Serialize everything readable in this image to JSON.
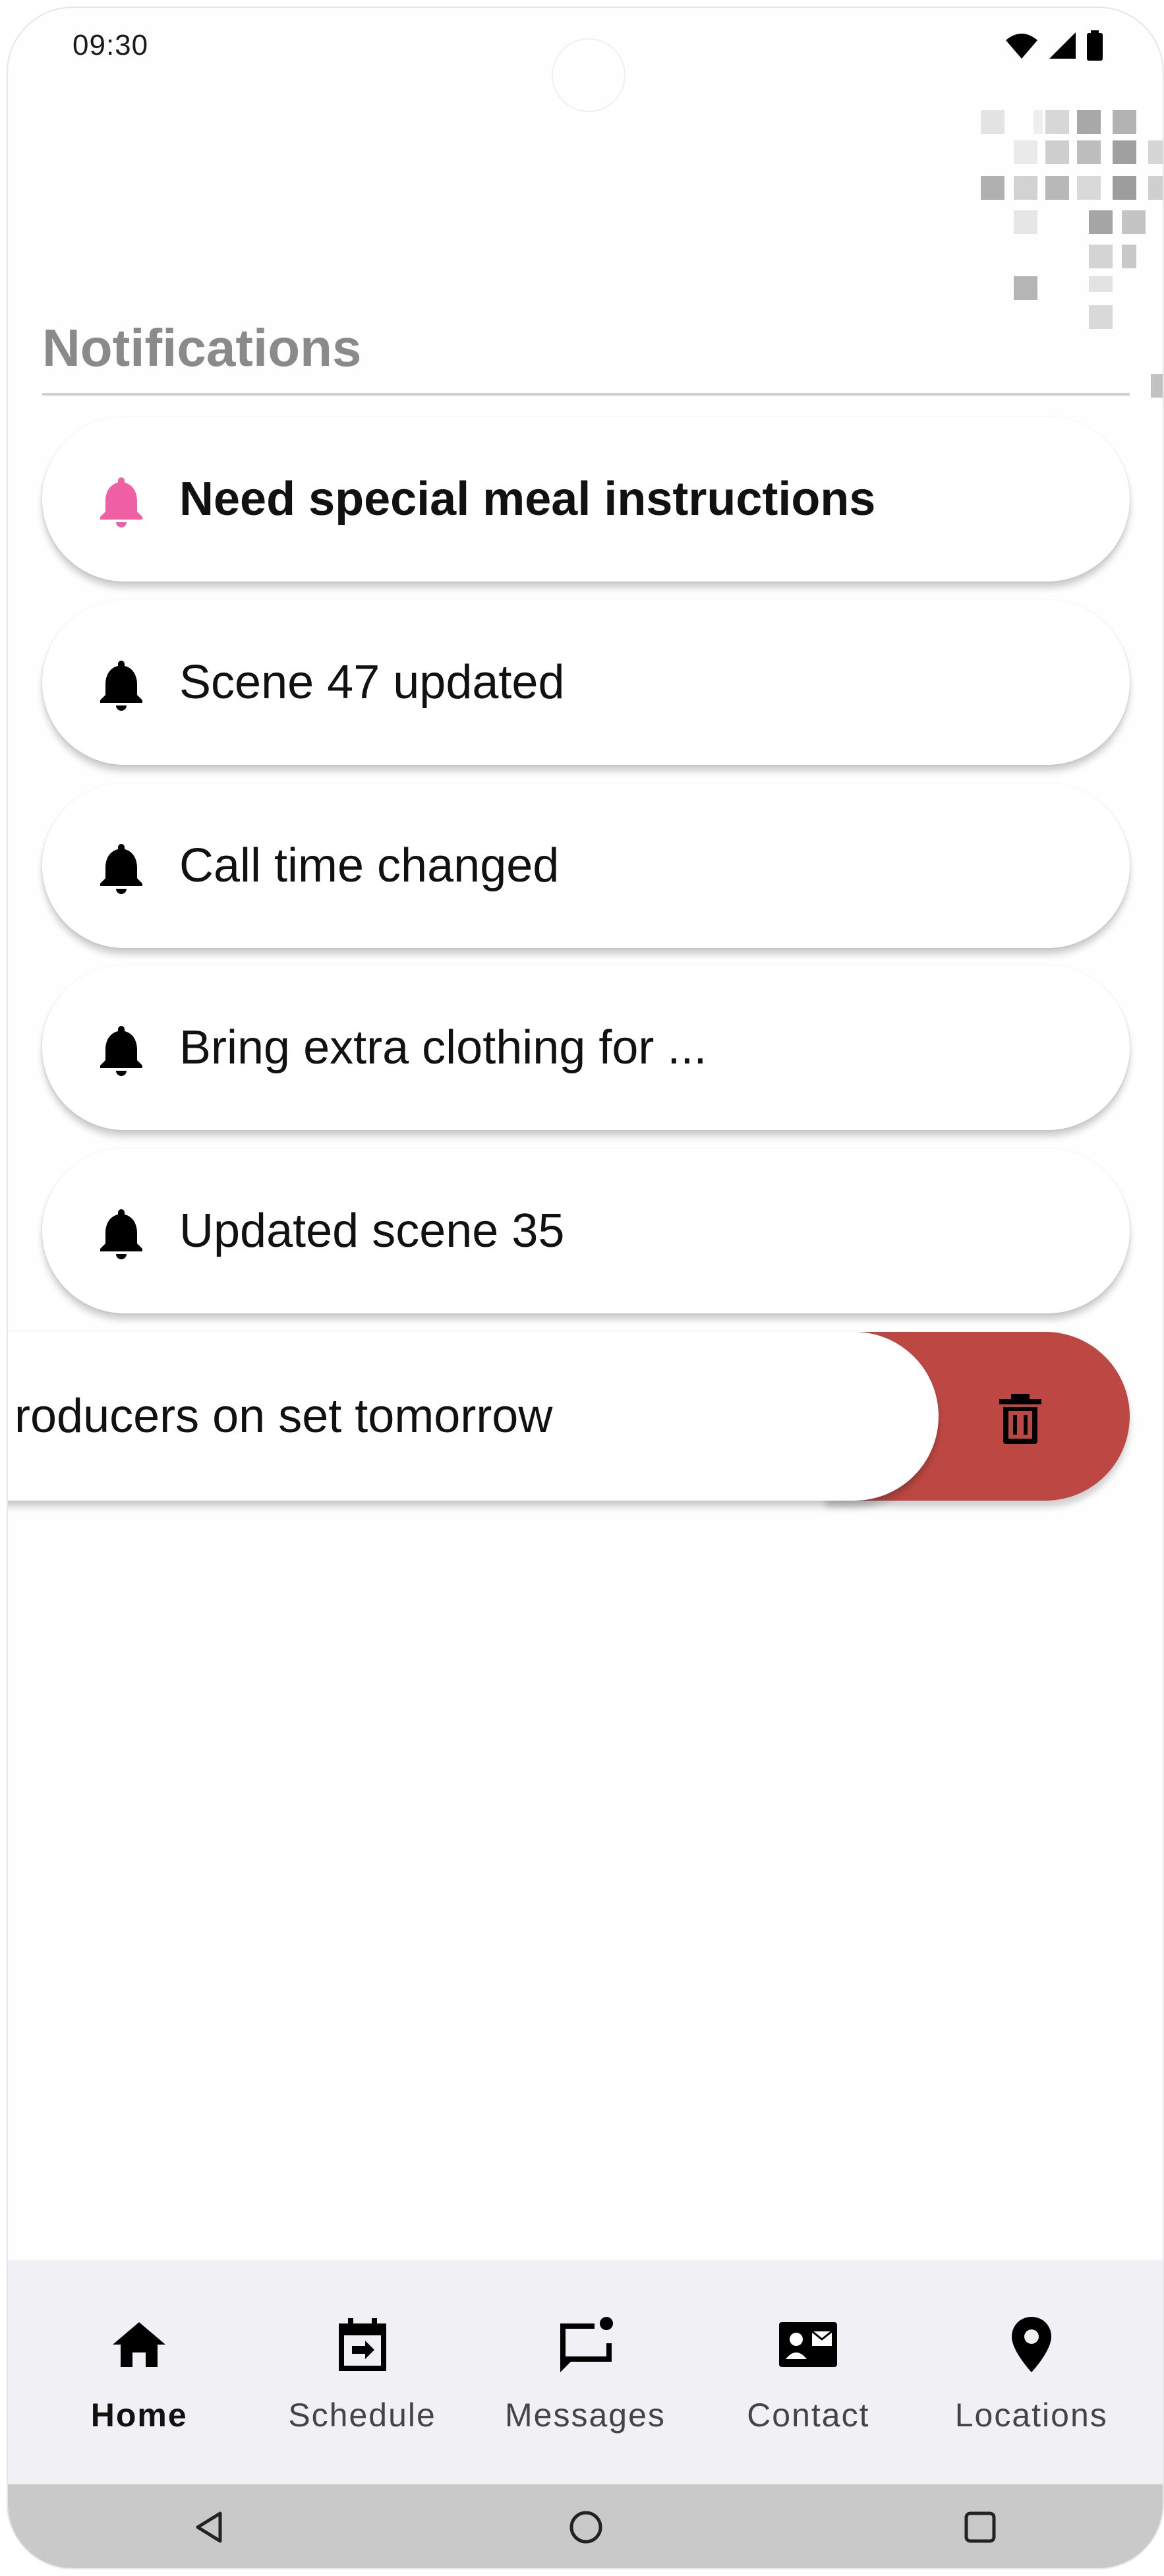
{
  "status_bar": {
    "time": "09:30",
    "icons": [
      "wifi-icon",
      "cellular-signal-icon",
      "battery-icon"
    ]
  },
  "header": {
    "title": "Notifications"
  },
  "notifications": [
    {
      "text": "Need special meal instructions",
      "unread": true,
      "icon": "bell-icon",
      "icon_color": "#ee5fa4"
    },
    {
      "text": "Scene 47 updated",
      "unread": false,
      "icon": "bell-icon",
      "icon_color": "#000000"
    },
    {
      "text": "Call time changed",
      "unread": false,
      "icon": "bell-icon",
      "icon_color": "#000000"
    },
    {
      "text": "Bring extra clothing for ...",
      "unread": false,
      "icon": "bell-icon",
      "icon_color": "#000000"
    },
    {
      "text": "Updated scene 35",
      "unread": false,
      "icon": "bell-icon",
      "icon_color": "#000000"
    }
  ],
  "swiped_notification": {
    "text": "roducers on set tomorrow",
    "action_icon": "trash-icon",
    "action_color": "#bd4843"
  },
  "bottom_nav": {
    "items": [
      {
        "label": "Home",
        "icon": "home-icon",
        "active": true
      },
      {
        "label": "Schedule",
        "icon": "calendar-icon",
        "active": false
      },
      {
        "label": "Messages",
        "icon": "message-icon",
        "active": false
      },
      {
        "label": "Contact",
        "icon": "contact-card-icon",
        "active": false
      },
      {
        "label": "Locations",
        "icon": "location-pin-icon",
        "active": false
      }
    ]
  },
  "system_nav": {
    "buttons": [
      "back-icon",
      "home-circle-icon",
      "recents-icon"
    ]
  },
  "colors": {
    "accent_pink": "#ee5fa4",
    "delete_red": "#bd4843",
    "nav_background": "#f1f0f5",
    "title_gray": "#8a8a8a"
  }
}
